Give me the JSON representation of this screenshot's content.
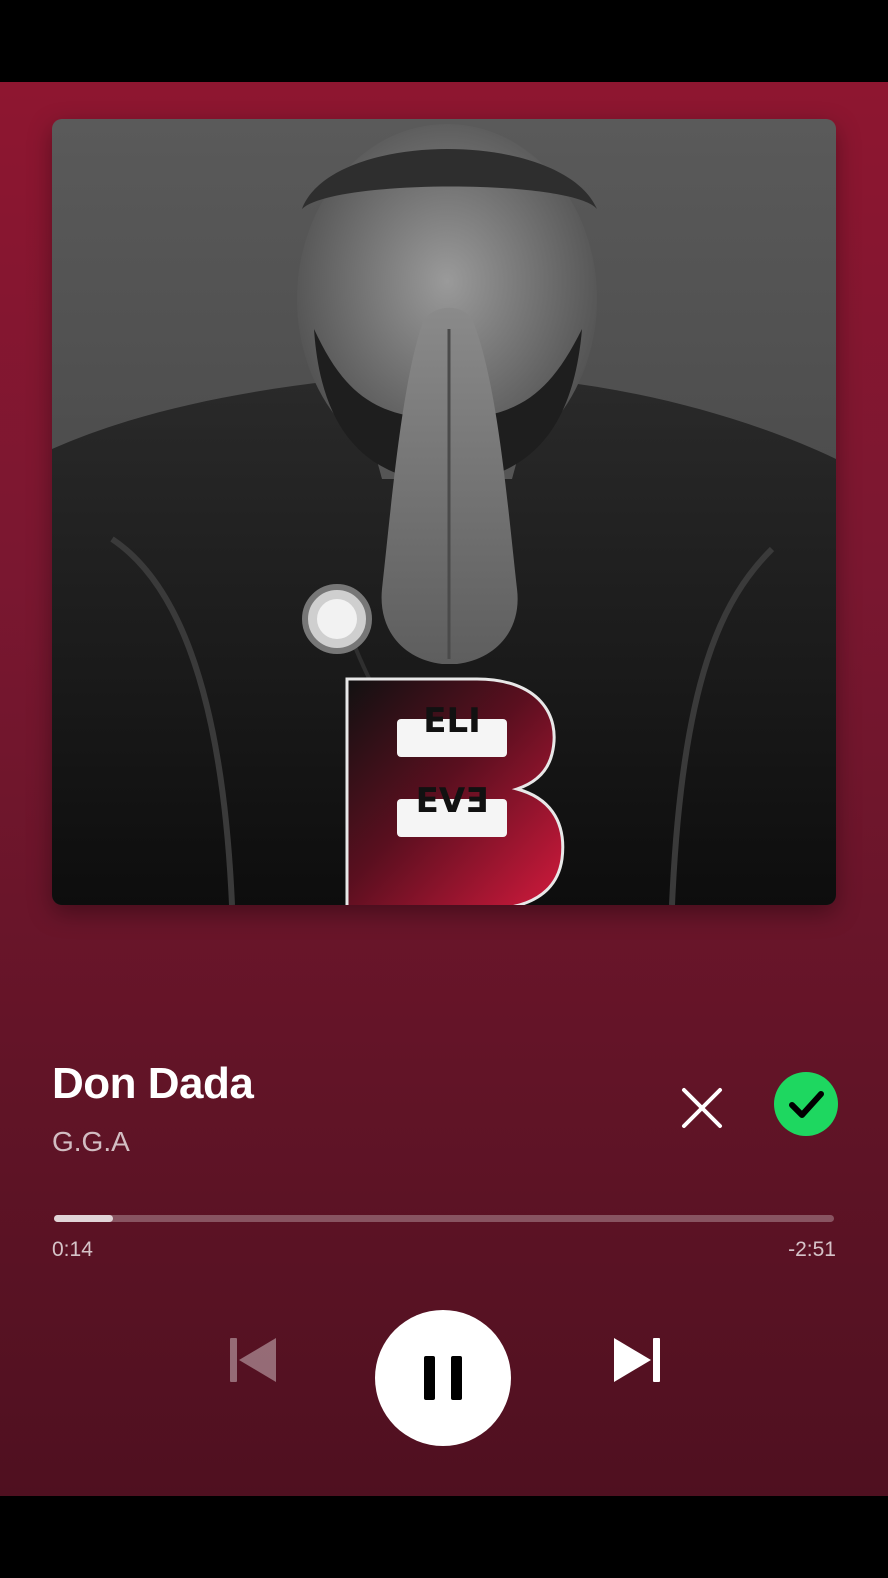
{
  "track": {
    "title": "Don Dada",
    "artist": "G.G.A"
  },
  "artwork": {
    "icon": "album-art-praying-hands",
    "logo_top_text": "ELI",
    "logo_bottom_text": "EVƎ"
  },
  "playback": {
    "elapsed": "0:14",
    "remaining": "-2:51",
    "progress_fraction": 0.076,
    "state": "playing"
  },
  "actions": {
    "dismiss_icon": "close-icon",
    "save_icon": "check-icon"
  },
  "controls": {
    "previous_icon": "skip-previous-icon",
    "pause_icon": "pause-icon",
    "next_icon": "skip-next-icon"
  },
  "colors": {
    "background_top": "#8e1630",
    "background_bottom": "#4f1020",
    "accent_green": "#1ed760",
    "logo_red": "#d31a3d"
  }
}
